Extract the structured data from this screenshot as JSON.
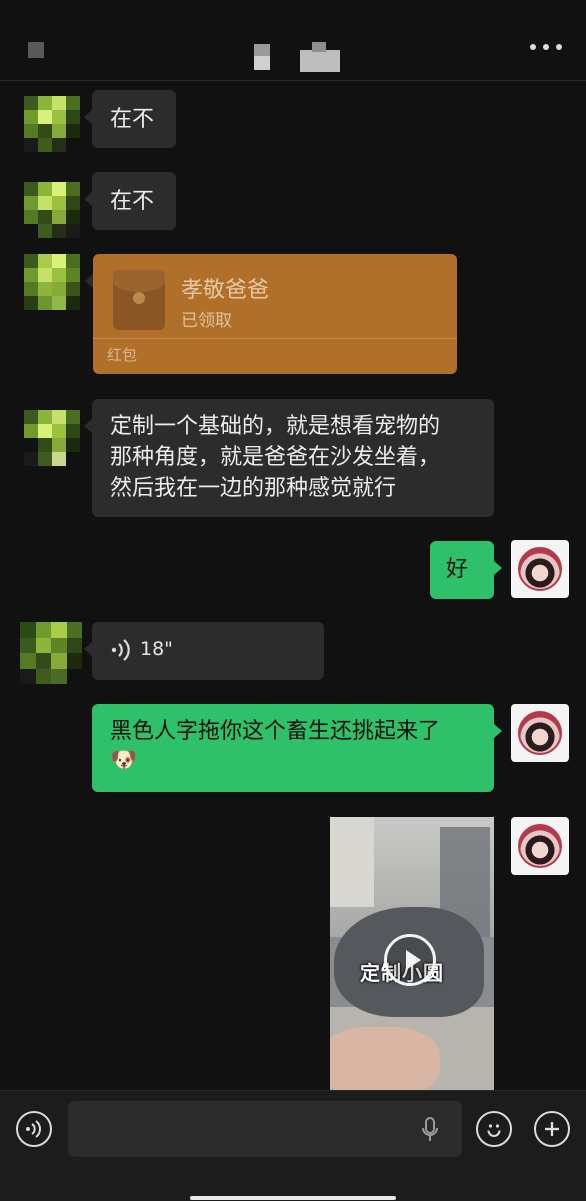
{
  "header": {
    "title": "",
    "more_icon": "more-dots-icon"
  },
  "messages": [
    {
      "side": "left",
      "type": "text",
      "text": "在不"
    },
    {
      "side": "left",
      "type": "text",
      "text": "在不"
    },
    {
      "side": "left",
      "type": "red_packet",
      "title": "孝敬爸爸",
      "status": "已领取",
      "label": "红包"
    },
    {
      "side": "left",
      "type": "text",
      "lines": [
        "定制一个基础的，就是想看宠物的",
        "那种角度，就是爸爸在沙发坐着，",
        "然后我在一边的那种感觉就行"
      ]
    },
    {
      "side": "right",
      "type": "text",
      "text": "好"
    },
    {
      "side": "left",
      "type": "voice",
      "duration": "18\""
    },
    {
      "side": "right",
      "type": "text",
      "lines": [
        "黑色人字拖你这个畜生还挑起来了",
        "🐶"
      ]
    },
    {
      "side": "right",
      "type": "video",
      "caption": "定制小圆"
    }
  ],
  "input_bar": {
    "voice_toggle_icon": "voice-toggle-icon",
    "placeholder": "",
    "mic_icon": "microphone-icon",
    "emoji_icon": "emoji-icon",
    "plus_icon": "plus-icon"
  },
  "colors": {
    "background": "#111111",
    "bubble_left": "#2c2c2c",
    "bubble_right": "#2fc06a",
    "red_packet": "#b0702a"
  }
}
